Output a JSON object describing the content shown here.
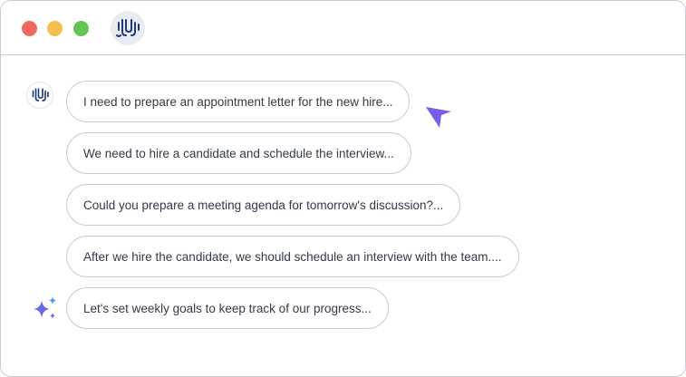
{
  "window": {
    "controls": [
      "close",
      "minimize",
      "maximize"
    ],
    "logo_icon": "brain-logo-icon"
  },
  "chat": {
    "bot_avatar_icon": "brain-logo-icon",
    "sparkle_icon": "ai-sparkle-icon",
    "suggestions": [
      "I need to prepare an appointment letter for the new hire...",
      "We need to hire a candidate and schedule the interview...",
      "Could you prepare a meeting agenda for tomorrow's discussion?...",
      "After we hire the candidate, we should schedule an interview with the team....",
      "Let's set weekly goals to keep track of our progress..."
    ]
  },
  "colors": {
    "accent": "#7b5ce6",
    "close": "#ee6a5f",
    "minimize": "#f5be4f",
    "maximize": "#62c554",
    "logo": "#1f3a7a"
  }
}
